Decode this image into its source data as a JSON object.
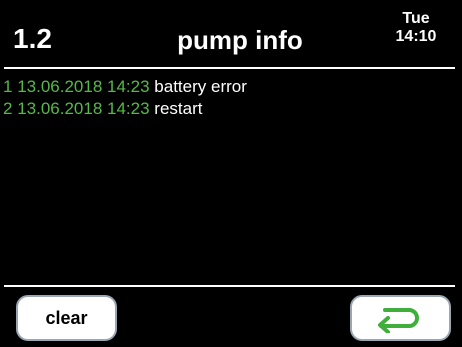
{
  "header": {
    "menu_number": "1.2",
    "title": "pump info",
    "day": "Tue",
    "time": "14:10"
  },
  "log": [
    {
      "index": "1",
      "timestamp": "13.06.2018 14:23",
      "message": "battery error"
    },
    {
      "index": "2",
      "timestamp": "13.06.2018 14:23",
      "message": "restart"
    }
  ],
  "footer": {
    "clear_label": "clear",
    "back_icon": "return-arrow-icon"
  },
  "colors": {
    "background": "#000000",
    "timestamp": "#57b947",
    "back_arrow": "#3fae3a",
    "button_border": "#9aa7b2"
  }
}
